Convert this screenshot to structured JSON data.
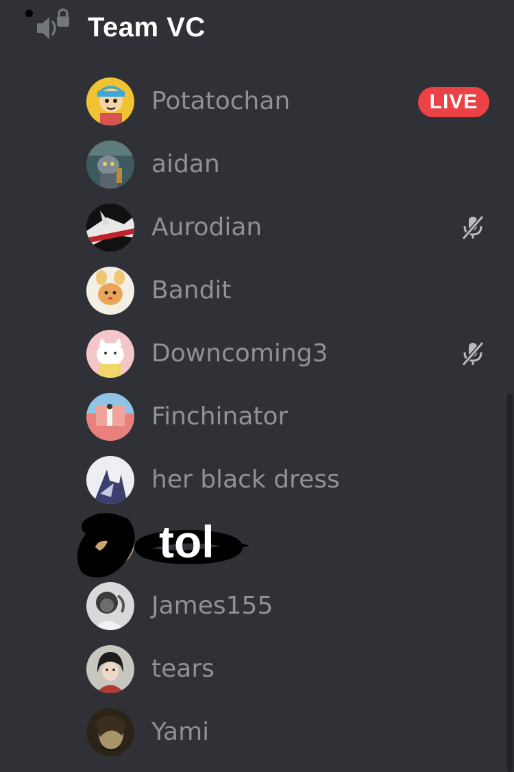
{
  "channel": {
    "name": "Team VC",
    "icon": "locked-voice-channel-icon"
  },
  "members": [
    {
      "name": "Potatochan",
      "badge": "LIVE",
      "muted": false
    },
    {
      "name": "aidan",
      "muted": false
    },
    {
      "name": "Aurodian",
      "muted": true
    },
    {
      "name": "Bandit",
      "muted": false
    },
    {
      "name": "Downcoming3",
      "muted": true
    },
    {
      "name": "Finchinator",
      "muted": false
    },
    {
      "name": "her black dress",
      "muted": false
    },
    {
      "name": "tol",
      "muted": false,
      "note": "handwritten overlay label"
    },
    {
      "name": "James155",
      "muted": false
    },
    {
      "name": "tears",
      "muted": false
    },
    {
      "name": "Yami",
      "muted": false
    }
  ],
  "colors": {
    "background": "#2f3136",
    "member_name": "#8e9297",
    "header_text": "#ffffff",
    "live_badge": "#ed4245",
    "scrollbar": "#202225"
  },
  "icons": {
    "mute": "microphone-muted-icon"
  }
}
